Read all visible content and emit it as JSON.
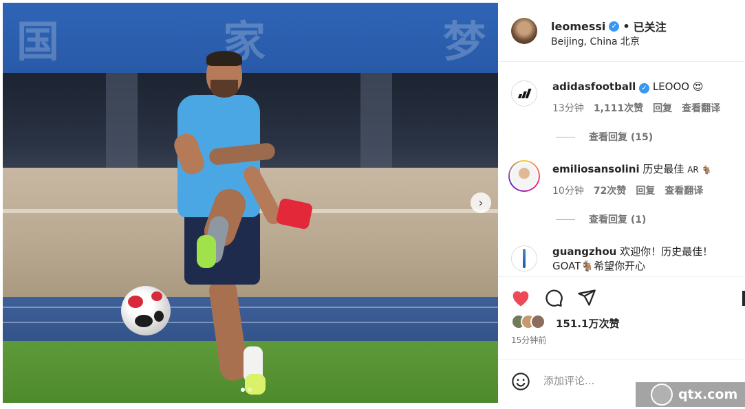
{
  "post": {
    "username": "leomessi",
    "separator": "•",
    "follow_status": "已关注",
    "location": "Beijing, China 北京",
    "image_next": "›"
  },
  "comments": [
    {
      "user": "adidasfootball",
      "text": "LEOOO 😍",
      "time": "13分钟",
      "likes": "1,111次赞",
      "reply": "回复",
      "translate": "查看翻译",
      "view_replies": "查看回复 (15)"
    },
    {
      "user": "emiliosansolini",
      "text": "历史最佳",
      "badge": "AR 🐐",
      "time": "10分钟",
      "likes": "72次赞",
      "reply": "回复",
      "translate": "查看翻译",
      "view_replies": "查看回复 (1)"
    },
    {
      "user": "guangzhou",
      "text": "欢迎你！历史最佳！GOAT🐐希望你开心"
    }
  ],
  "actions": {
    "likes_count": "151.1万次赞",
    "time_ago": "15分钟前"
  },
  "add_comment": {
    "placeholder": "添加评论..."
  },
  "watermark": {
    "text": "qtx.com"
  },
  "colors": {
    "like_red": "#ed4956",
    "verified_blue": "#3897f0",
    "meta_gray": "#737373"
  }
}
